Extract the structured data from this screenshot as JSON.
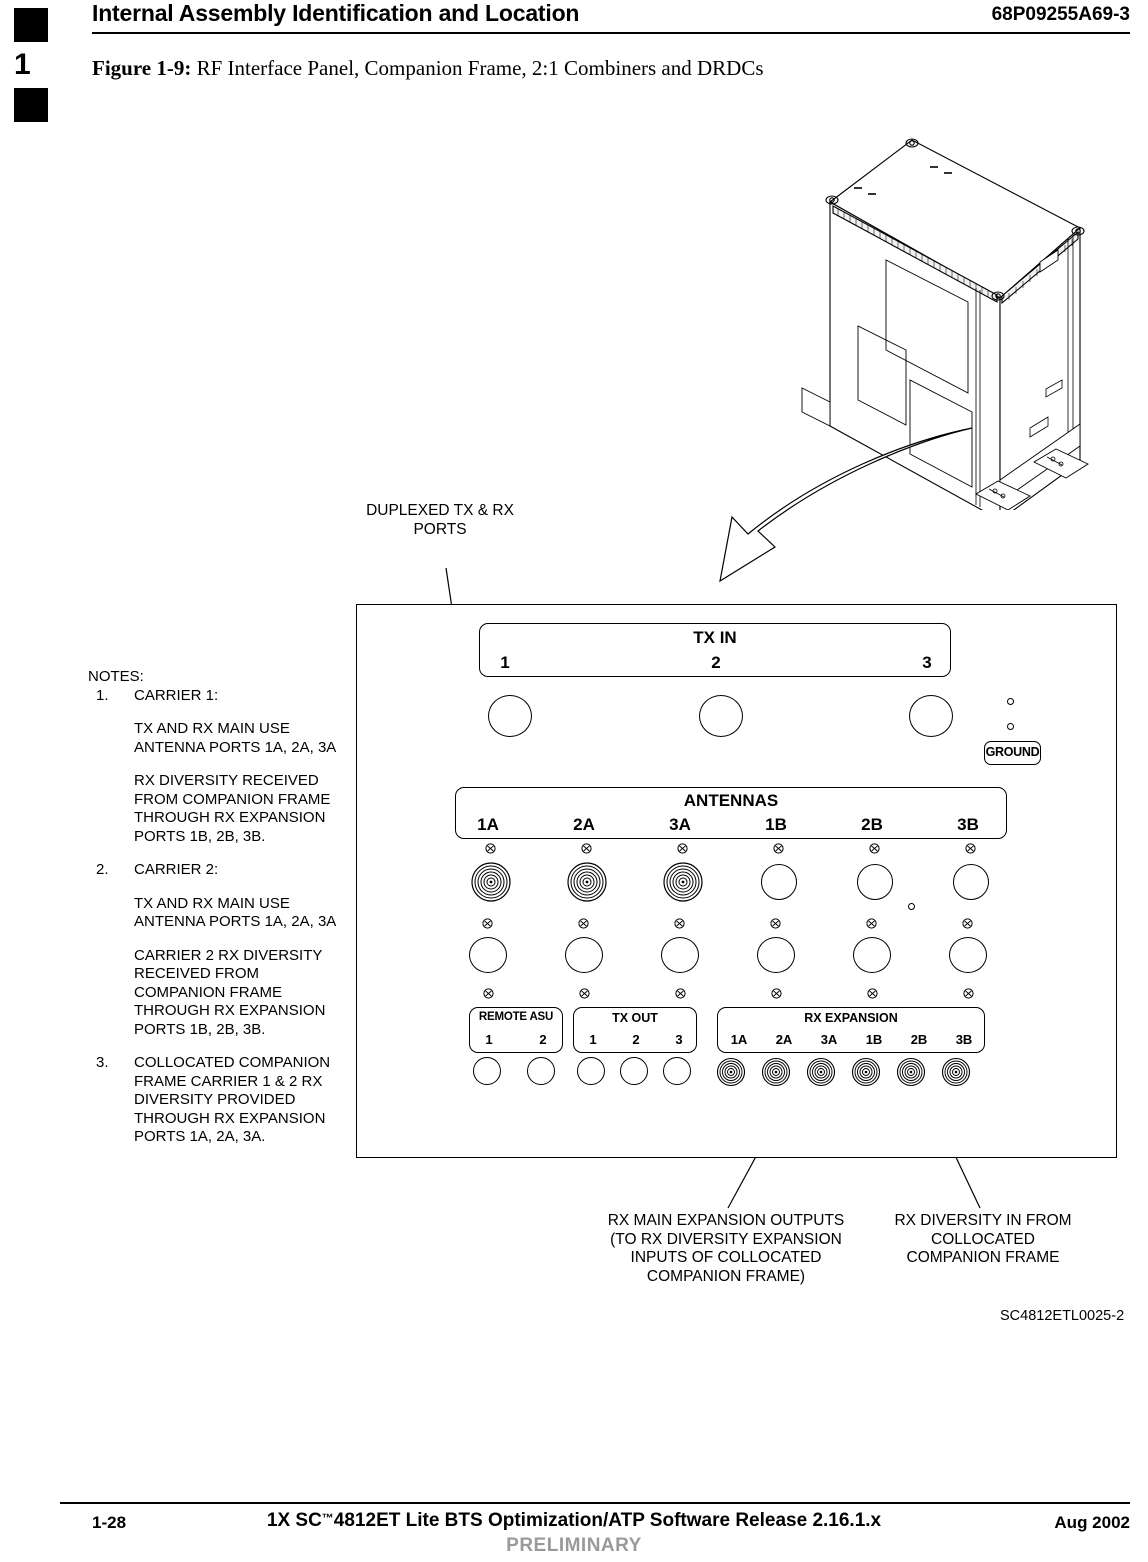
{
  "header": {
    "title": "Internal Assembly Identification and Location",
    "part_number": "68P09255A69-3",
    "chapter_tab": "1"
  },
  "figure": {
    "label": "Figure 1-9:",
    "caption": " RF Interface Panel, Companion Frame, 2:1 Combiners and DRDCs",
    "drawing_id": "SC4812ETL0025-2"
  },
  "notes": {
    "heading": "NOTES:",
    "items": [
      {
        "num": "1.",
        "title": "CARRIER 1:",
        "paragraphs": [
          "TX AND RX MAIN USE ANTENNA PORTS 1A, 2A, 3A",
          "RX DIVERSITY RECEIVED FROM COMPANION FRAME THROUGH RX EXPANSION PORTS 1B, 2B, 3B."
        ]
      },
      {
        "num": "2.",
        "title": "CARRIER 2:",
        "paragraphs": [
          "TX AND RX MAIN USE ANTENNA PORTS 1A, 2A, 3A",
          "CARRIER 2 RX DIVERSITY RECEIVED FROM COMPANION FRAME THROUGH RX EXPANSION PORTS 1B, 2B, 3B."
        ]
      },
      {
        "num": "3.",
        "title": "COLLOCATED COMPANION FRAME CARRIER 1 & 2 RX DIVERSITY PROVIDED THROUGH RX EXPANSION PORTS 1A, 2A, 3A.",
        "paragraphs": []
      }
    ]
  },
  "callouts": {
    "duplexed": "DUPLEXED TX & RX PORTS",
    "rx_main_expansion": "RX MAIN EXPANSION OUTPUTS (TO RX DIVERSITY EXPANSION INPUTS OF COLLOCATED COMPANION FRAME)",
    "rx_diversity_in": "RX DIVERSITY IN FROM COLLOCATED COMPANION FRAME"
  },
  "panel": {
    "tx_in": {
      "title": "TX IN",
      "ports": [
        "1",
        "2",
        "3"
      ]
    },
    "antennas": {
      "title": "ANTENNAS",
      "ports": [
        "1A",
        "2A",
        "3A",
        "1B",
        "2B",
        "3B"
      ]
    },
    "ground": {
      "label": "GROUND"
    },
    "remote_asu": {
      "title": "REMOTE  ASU",
      "ports": [
        "1",
        "2"
      ]
    },
    "tx_out": {
      "title": "TX OUT",
      "ports": [
        "1",
        "2",
        "3"
      ]
    },
    "rx_expansion": {
      "title": "RX  EXPANSION",
      "ports": [
        "1A",
        "2A",
        "3A",
        "1B",
        "2B",
        "3B"
      ]
    }
  },
  "footer": {
    "page_number": "1-28",
    "center_pre": "1X SC",
    "center_tm": "™",
    "center_post": "4812ET Lite BTS Optimization/ATP Software Release 2.16.1.x",
    "date": "Aug 2002",
    "status": "PRELIMINARY"
  },
  "colors": {
    "ink": "#000000",
    "paper": "#ffffff",
    "preliminary_gray": "#9a9a9a"
  }
}
